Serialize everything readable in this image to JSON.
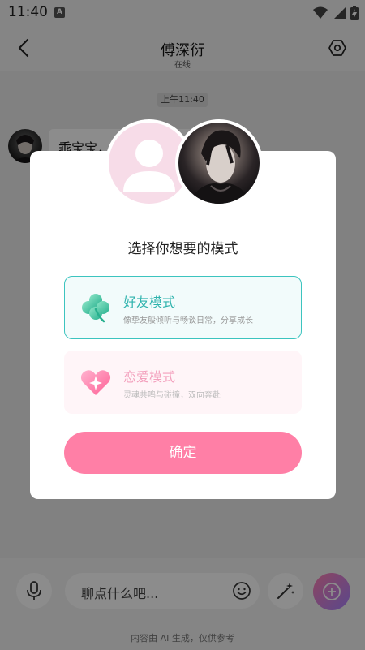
{
  "status_bar": {
    "time": "11:40",
    "a_icon": "A"
  },
  "header": {
    "title": "傅深衍",
    "subtitle": "在线"
  },
  "chat": {
    "timestamp": "上午11:40",
    "message": "乖宝宝，"
  },
  "input_bar": {
    "placeholder": "聊点什么吧...",
    "disclaimer": "内容由 AI 生成，仅供参考"
  },
  "dialog": {
    "title": "选择你想要的模式",
    "options": [
      {
        "name": "好友模式",
        "desc": "像挚友般倾听与畅谈日常，分享成长",
        "icon": "clover-icon",
        "selected": true
      },
      {
        "name": "恋爱模式",
        "desc": "灵魂共鸣与碰撞，双向奔赴",
        "icon": "heart-sparkle-icon",
        "selected": false
      }
    ],
    "confirm_label": "确定"
  },
  "colors": {
    "accent_teal": "#3cc4bf",
    "accent_pink": "#ff7fa6",
    "pink_text": "#f3a0bd"
  }
}
